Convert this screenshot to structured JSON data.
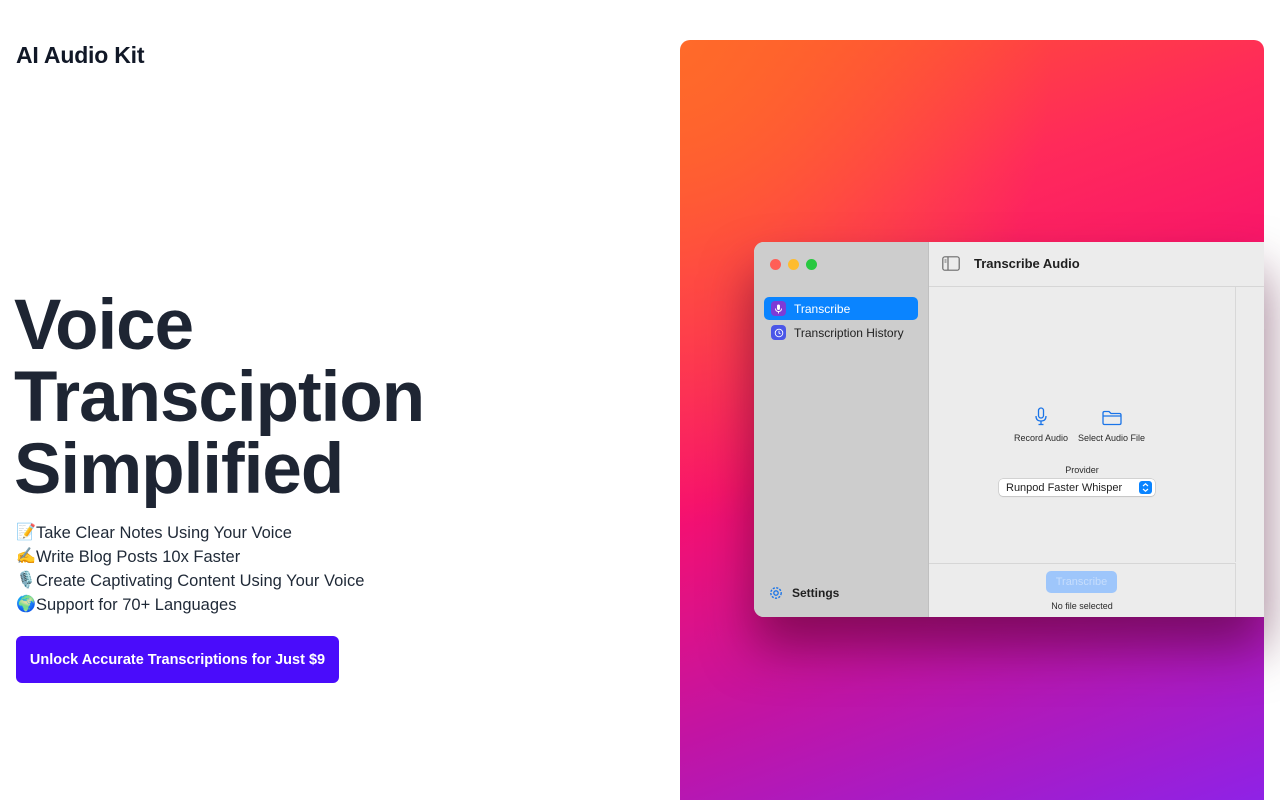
{
  "brand": "AI Audio Kit",
  "hero": {
    "line1": "Voice",
    "line2": "Transciption",
    "line3": "Simplified"
  },
  "features": [
    {
      "emoji": "📝",
      "text": "Take Clear Notes Using Your Voice"
    },
    {
      "emoji": "✍️",
      "text": "Write Blog Posts 10x Faster"
    },
    {
      "emoji": "🎙️",
      "text": "Create Captivating Content Using Your Voice"
    },
    {
      "emoji": "🌍",
      "text": "Support for 70+ Languages"
    }
  ],
  "cta": {
    "label": "Unlock Accurate Transcriptions for Just $9",
    "color": "#4a0cfb"
  },
  "app": {
    "sidebar": {
      "items": [
        {
          "label": "Transcribe",
          "icon": "mic-icon",
          "active": true
        },
        {
          "label": "Transcription History",
          "icon": "clock-icon",
          "active": false
        }
      ],
      "settings_label": "Settings"
    },
    "toolbar": {
      "title": "Transcribe Audio"
    },
    "actions": {
      "record_label": "Record Audio",
      "select_label": "Select Audio File"
    },
    "provider": {
      "label": "Provider",
      "selected": "Runpod Faster Whisper"
    },
    "transcribe_label": "Transcribe",
    "status": "No file selected"
  },
  "colors": {
    "accent": "#0a84ff",
    "gradient": [
      "#ff5a2a",
      "#f7106e",
      "#8f22e6"
    ]
  }
}
